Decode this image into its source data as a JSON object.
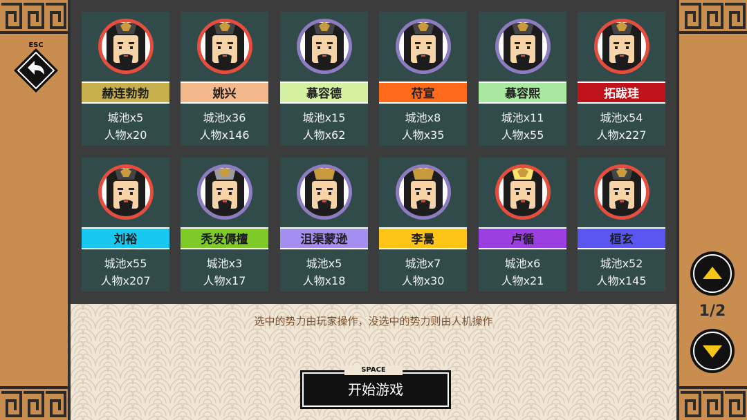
{
  "esc": {
    "key_label": "ESC"
  },
  "factions": [
    {
      "name": "赫连勃勃",
      "cities": "城池x5",
      "people": "人物x20",
      "color": "#c8b04e",
      "ring": "#e74c3c"
    },
    {
      "name": "姚兴",
      "cities": "城池x36",
      "people": "人物x146",
      "color": "#f4b98a",
      "ring": "#e74c3c"
    },
    {
      "name": "慕容德",
      "cities": "城池x15",
      "people": "人物x62",
      "color": "#d4f0a0",
      "ring": "#8e7cc3"
    },
    {
      "name": "苻宣",
      "cities": "城池x8",
      "people": "人物x35",
      "color": "#ff6a1a",
      "ring": "#8e7cc3"
    },
    {
      "name": "慕容熙",
      "cities": "城池x11",
      "people": "人物x55",
      "color": "#a8e8a0",
      "ring": "#8e7cc3"
    },
    {
      "name": "拓跋珪",
      "cities": "城池x54",
      "people": "人物x227",
      "color": "#c0121a",
      "ring": "#e74c3c"
    },
    {
      "name": "刘裕",
      "cities": "城池x55",
      "people": "人物x207",
      "color": "#18c8f0",
      "ring": "#e74c3c"
    },
    {
      "name": "秃发傉檀",
      "cities": "城池x3",
      "people": "人物x17",
      "color": "#7ecb28",
      "ring": "#8e7cc3"
    },
    {
      "name": "沮渠蒙逊",
      "cities": "城池x5",
      "people": "人物x18",
      "color": "#a48ef0",
      "ring": "#8e7cc3"
    },
    {
      "name": "李暠",
      "cities": "城池x7",
      "people": "人物x30",
      "color": "#ffc418",
      "ring": "#8e7cc3"
    },
    {
      "name": "卢循",
      "cities": "城池x6",
      "people": "人物x21",
      "color": "#9b40e0",
      "ring": "#e74c3c"
    },
    {
      "name": "桓玄",
      "cities": "城池x52",
      "people": "人物x145",
      "color": "#5a56f0",
      "ring": "#e74c3c"
    }
  ],
  "hint_text": "选中的势力由玩家操作，没选中的势力则由人机操作",
  "start_button": {
    "key_label": "SPACE",
    "label": "开始游戏"
  },
  "pagination": {
    "current": "1/2"
  },
  "icons": {
    "back": "back-arrow-icon",
    "up": "triangle-up-icon",
    "down": "triangle-down-icon"
  }
}
